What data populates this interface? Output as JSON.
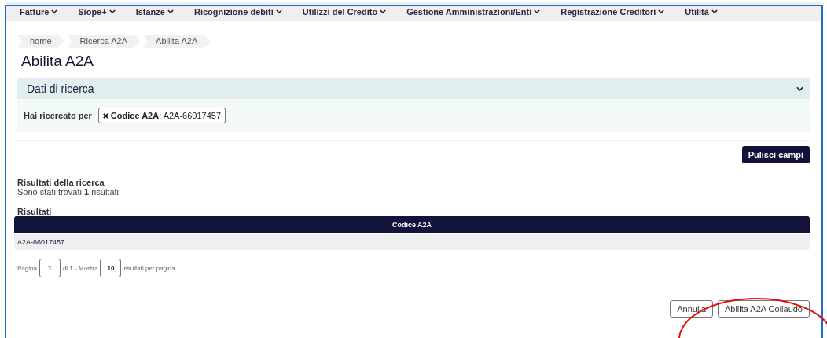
{
  "menu": [
    {
      "label": "Fatture"
    },
    {
      "label": "Siope+"
    },
    {
      "label": "Istanze"
    },
    {
      "label": "Ricognizione debiti"
    },
    {
      "label": "Utilizzi del Credito"
    },
    {
      "label": "Gestione Amministrazioni/Enti"
    },
    {
      "label": "Registrazione Creditori"
    },
    {
      "label": "Utilità"
    }
  ],
  "breadcrumb": [
    "home",
    "Ricerca A2A",
    "Abilita A2A"
  ],
  "title": "Abilita A2A",
  "search_panel": {
    "title": "Dati di ricerca",
    "expanded": true,
    "label": "Hai ricercato per",
    "filter": "**Codice A2A**: A2A-66017457"
  },
  "clear_button": "Pulisci campi",
  "results": {
    "heading": "Risultati della ricerca",
    "summary": "Sono stati trovati **1** risultati",
    "table_title": "Risultati",
    "columns": [
      "Codice A2A"
    ],
    "rows": [
      [
        "A2A-66017457"
      ]
    ]
  },
  "pagination": {
    "page_label": "Pagina",
    "page": "1",
    "of": "di 1 - Mostra",
    "per_page": "10",
    "suffix": "risultati per pagina"
  },
  "actions": [
    "Annulla",
    "Abilita A2A Collaudo"
  ]
}
